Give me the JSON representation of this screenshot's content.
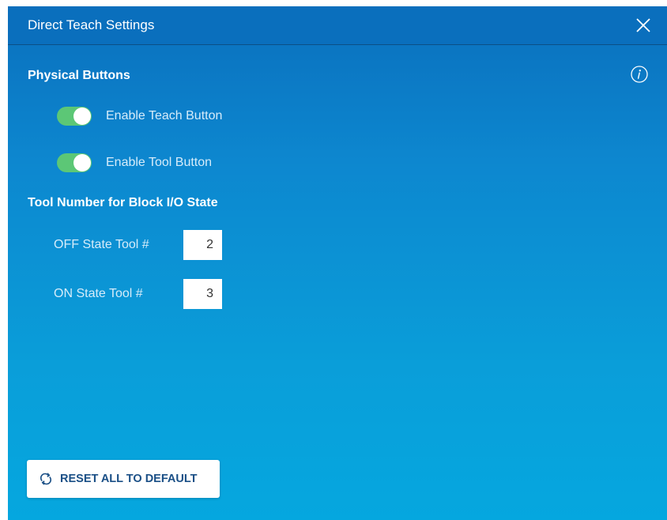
{
  "dialog": {
    "title": "Direct Teach Settings",
    "close_icon": "close-icon",
    "colors": {
      "header": "#0a6fbd",
      "toggle_on": "#5cc776",
      "button_text": "#1a4f86"
    }
  },
  "physical_buttons": {
    "heading": "Physical Buttons",
    "info_icon": "info-icon",
    "toggles": [
      {
        "label": "Enable Teach Button",
        "state": "on"
      },
      {
        "label": "Enable Tool Button",
        "state": "on"
      }
    ]
  },
  "tool_number": {
    "heading": "Tool Number for Block I/O State",
    "fields": [
      {
        "label": "OFF State Tool #",
        "value": "2"
      },
      {
        "label": "ON State Tool #",
        "value": "3"
      }
    ]
  },
  "footer": {
    "reset_label": "RESET ALL TO DEFAULT",
    "reset_icon": "refresh-icon"
  }
}
